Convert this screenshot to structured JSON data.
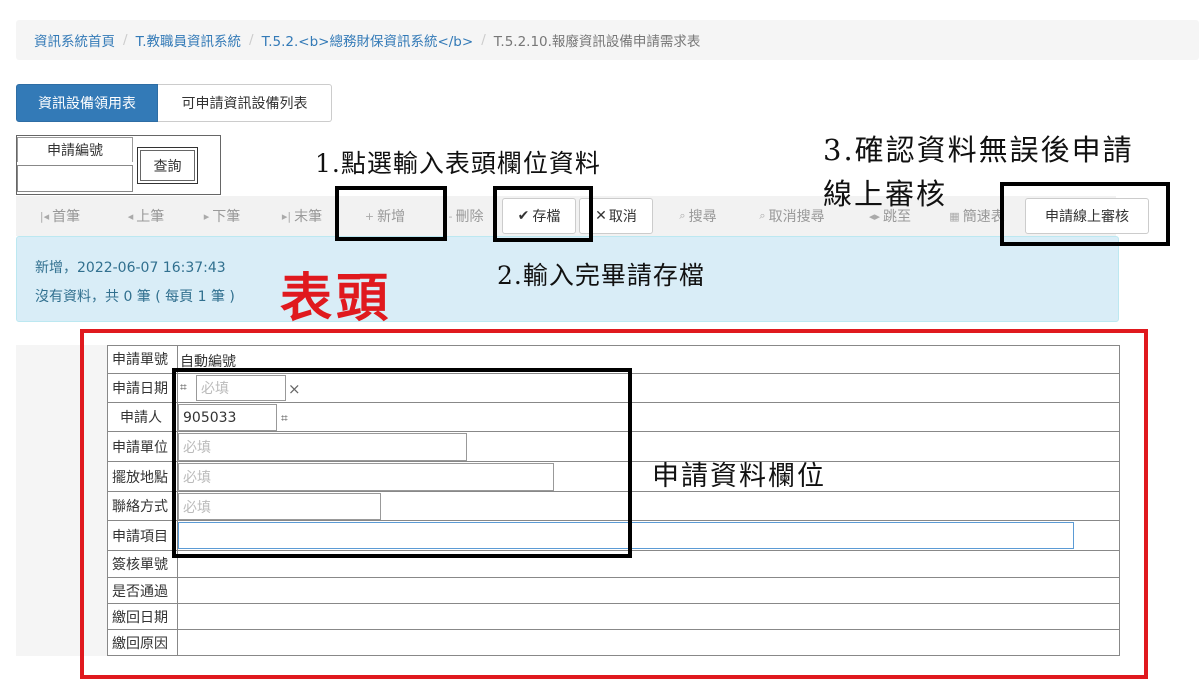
{
  "breadcrumb": {
    "items": [
      "資訊系統首頁",
      "T.教職員資訊系統",
      "T.5.2.<b>總務財保資訊系統</b>"
    ],
    "current": "T.5.2.10.報廢資訊設備申請需求表",
    "separator": "/"
  },
  "tabs": [
    {
      "label": "資訊設備領用表",
      "active": true
    },
    {
      "label": "可申請資訊設備列表",
      "active": false
    }
  ],
  "query": {
    "label": "申請編號",
    "value": "",
    "button": "查詢"
  },
  "toolbar": {
    "first": "首筆",
    "prev": "上筆",
    "next": "下筆",
    "last": "末筆",
    "add": "新增",
    "delete": "刪除",
    "save": "存檔",
    "cancel": "取消",
    "search": "搜尋",
    "cancel_search": "取消搜尋",
    "jump": "跳至",
    "quick_table": "簡速表",
    "submit_review": "申請線上審核"
  },
  "status": {
    "line1": "新增，2022-06-07 16:37:43",
    "line2": "沒有資料，共 0 筆 ( 每頁 1 筆 )"
  },
  "annotations": {
    "step1": "1.點選輸入表頭欄位資料",
    "step2": "2.輸入完畢請存檔",
    "step3_line1": "3.確認資料無誤後申請",
    "step3_line2": "線上審核",
    "header_label": "表頭",
    "fields_label": "申請資料欄位"
  },
  "form": {
    "rows": [
      {
        "label": "申請單號",
        "value": "自動編號"
      },
      {
        "label": "申請日期",
        "placeholder": "必填"
      },
      {
        "label": "申請人",
        "value": "905033"
      },
      {
        "label": "申請單位",
        "placeholder": "必填"
      },
      {
        "label": "擺放地點",
        "placeholder": "必填"
      },
      {
        "label": "聯絡方式",
        "placeholder": "必填"
      },
      {
        "label": "申請項目",
        "value": ""
      },
      {
        "label": "簽核單號",
        "value": ""
      },
      {
        "label": "是否通過",
        "value": ""
      },
      {
        "label": "繳回日期",
        "value": ""
      },
      {
        "label": "繳回原因",
        "value": ""
      }
    ]
  },
  "colors": {
    "primary": "#337ab7",
    "info_bg": "#d9edf7",
    "info_text": "#31708f",
    "annotation_red": "#e0191e"
  }
}
